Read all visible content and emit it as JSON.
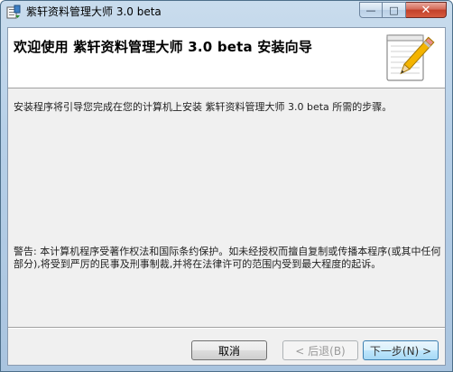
{
  "window": {
    "title": "紫轩资料管理大师 3.0 beta",
    "controls": {
      "minimize": "—",
      "maximize": "□",
      "close": "✕"
    }
  },
  "header": {
    "title": "欢迎使用 紫轩资料管理大师 3.0 beta 安装向导",
    "icon": "notepad-pencil-icon"
  },
  "body": {
    "intro": "安装程序将引导您完成在您的计算机上安装 紫轩资料管理大师 3.0 beta 所需的步骤。",
    "warning": "警告: 本计算机程序受著作权法和国际条约保护。如未经授权而擅自复制或传播本程序(或其中任何部分),将受到严厉的民事及刑事制裁,并将在法律许可的范围内受到最大程度的起诉。"
  },
  "buttons": {
    "cancel": "取消",
    "back": "< 后退(B)",
    "next": "下一步(N) >"
  },
  "colors": {
    "title_bar": "#b7d0e8",
    "client_bg": "#f0f0f0",
    "close_button": "#c2402a",
    "default_button_border": "#3c7fb1"
  }
}
